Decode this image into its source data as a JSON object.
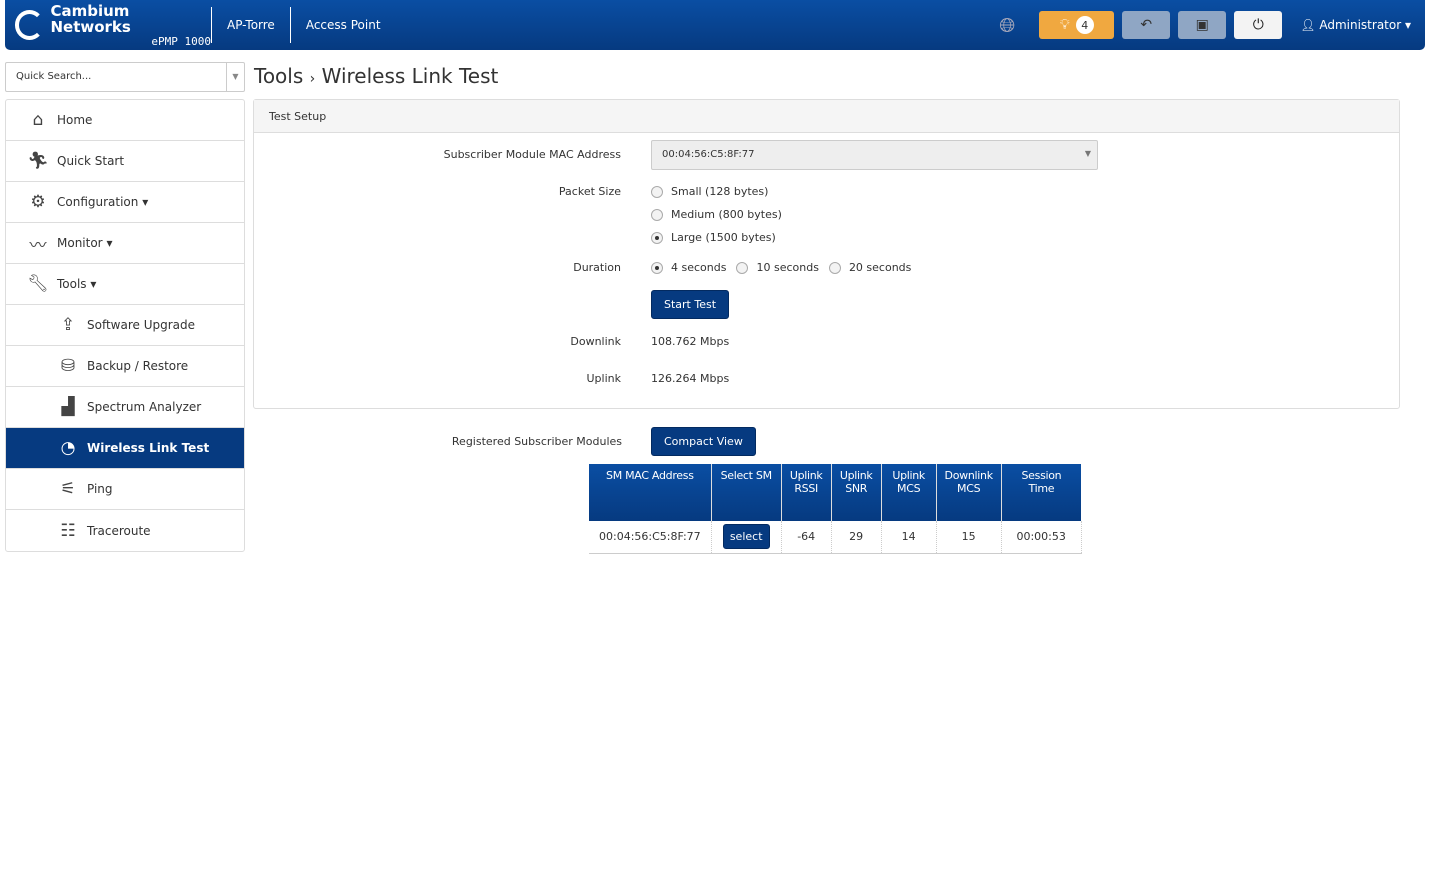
{
  "header": {
    "brand": "Cambium Networks",
    "model": "ePMP 1000",
    "device_name": "AP-Torre",
    "mode": "Access Point",
    "alerts_count": "4",
    "user": "Administrator",
    "accent": "#063a80"
  },
  "search": {
    "placeholder": "Quick Search..."
  },
  "sidebar": {
    "items": [
      {
        "label": "Home",
        "icon": "home-icon"
      },
      {
        "label": "Quick Start",
        "icon": "run-icon"
      },
      {
        "label": "Configuration",
        "icon": "gear-icon"
      },
      {
        "label": "Monitor",
        "icon": "pulse-icon"
      },
      {
        "label": "Tools",
        "icon": "wrench-icon"
      },
      {
        "label": "Software Upgrade",
        "icon": "upgrade-icon"
      },
      {
        "label": "Backup / Restore",
        "icon": "backup-icon"
      },
      {
        "label": "Spectrum Analyzer",
        "icon": "bar-chart-icon"
      },
      {
        "label": "Wireless Link Test",
        "icon": "gauge-icon"
      },
      {
        "label": "Ping",
        "icon": "ping-icon"
      },
      {
        "label": "Traceroute",
        "icon": "traceroute-icon"
      }
    ]
  },
  "breadcrumb": {
    "parent": "Tools",
    "current": "Wireless Link Test"
  },
  "test_setup": {
    "title": "Test Setup",
    "mac_label": "Subscriber Module MAC Address",
    "mac_value": "00:04:56:C5:8F:77",
    "packet_label": "Packet Size",
    "packet_options": [
      "Small (128 bytes)",
      "Medium (800 bytes)",
      "Large (1500 bytes)"
    ],
    "packet_selected": "Large (1500 bytes)",
    "duration_label": "Duration",
    "duration_options": [
      "4 seconds",
      "10 seconds",
      "20 seconds"
    ],
    "duration_selected": "4 seconds",
    "start_label": "Start Test",
    "downlink_label": "Downlink",
    "downlink_value": "108.762 Mbps",
    "uplink_label": "Uplink",
    "uplink_value": "126.264 Mbps"
  },
  "registered": {
    "label": "Registered Subscriber Modules",
    "compact_label": "Compact View",
    "columns": [
      "SM MAC Address",
      "Select SM",
      "Uplink RSSI",
      "Uplink SNR",
      "Uplink MCS",
      "Downlink MCS",
      "Session Time"
    ],
    "rows": [
      {
        "mac": "00:04:56:C5:8F:77",
        "select": "select",
        "rssi": "-64",
        "snr": "29",
        "ul_mcs": "14",
        "dl_mcs": "15",
        "session": "00:00:53"
      }
    ]
  }
}
